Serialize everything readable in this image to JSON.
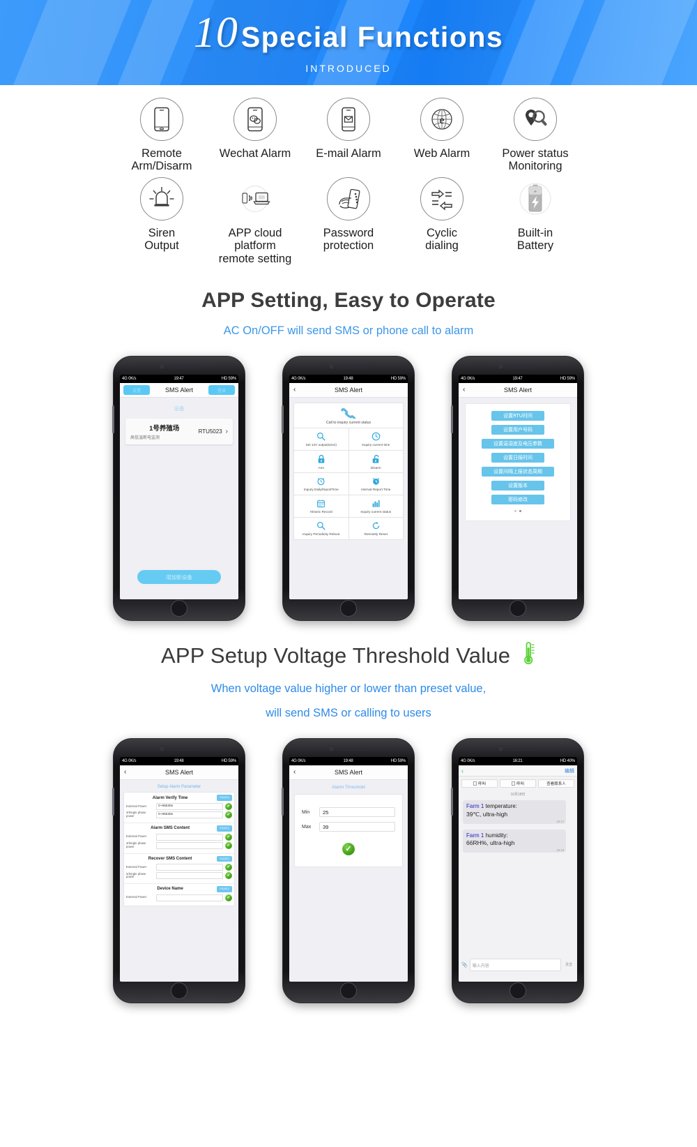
{
  "banner": {
    "number": "10",
    "title": "Special Functions",
    "subtitle": "INTRODUCED"
  },
  "features": {
    "row1": [
      {
        "icon": "smartphone-icon",
        "label": "Remote\nArm/Disarm"
      },
      {
        "icon": "wechat-chat-bubbles-icon",
        "label": "Wechat Alarm"
      },
      {
        "icon": "email-envelope-phone-icon",
        "label": "E-mail Alarm"
      },
      {
        "icon": "web-globe-icon",
        "label": "Web Alarm"
      },
      {
        "icon": "location-search-icon",
        "label": "Power status\nMonitoring"
      }
    ],
    "row2": [
      {
        "icon": "siren-light-icon",
        "label": "Siren\nOutput"
      },
      {
        "icon": "phone-to-laptop-icon",
        "label": "APP cloud platform\nremote setting"
      },
      {
        "icon": "hand-password-phone-icon",
        "label": "Password\nprotection"
      },
      {
        "icon": "cyclic-arrows-icon",
        "label": "Cyclic\ndialing"
      },
      {
        "icon": "battery-bolt-icon",
        "label": "Built-in\nBattery"
      }
    ]
  },
  "section1": {
    "title": "APP Setting, Easy to Operate",
    "subtitle": "AC On/OFF will send SMS or phone call to alarm"
  },
  "section2": {
    "title": "APP Setup Voltage Threshold Value",
    "icon": "thermometer-icon",
    "subtitle_line1": "When voltage value higher or lower than preset value,",
    "subtitle_line2": "will send SMS or calling to users"
  },
  "phone1": {
    "status_left": "4G  0K/s",
    "status_time": "19:47",
    "status_right": "HD  59%",
    "nav_left_button": "设置",
    "nav_title": "SMS Alert",
    "nav_right_button": "登录",
    "section_label": "设备",
    "device_name": "1号养殖场",
    "device_desc": "高低温断电监测",
    "device_model": "RTU5023",
    "chevron": "chevron-right-icon",
    "add_button": "增加新设备"
  },
  "phone2": {
    "status_left": "4G  0K/s",
    "status_time": "19:48",
    "status_right": "HD  59%",
    "nav_title": "SMS Alert",
    "back": "back-chevron-icon",
    "call_item": {
      "icon": "phone-handset-icon",
      "label": "Call to inquiry current status"
    },
    "grid": [
      [
        {
          "icon": "magnifier-icon",
          "label": "Set 12V output(siren)"
        },
        {
          "icon": "clock-icon",
          "label": "Inquiry current time"
        }
      ],
      [
        {
          "icon": "lock-closed-icon",
          "label": "Arm"
        },
        {
          "icon": "lock-open-icon",
          "label": "Disarm"
        }
      ],
      [
        {
          "icon": "alarm-clock-icon",
          "label": "Inquiry DailyReportTime"
        },
        {
          "icon": "alarm-clock-filled-icon",
          "label": "Interval Report Time"
        }
      ],
      [
        {
          "icon": "calendar-icon",
          "label": "Historic Record"
        },
        {
          "icon": "bar-chart-icon",
          "label": "Inquiry current status"
        }
      ],
      [
        {
          "icon": "magnifier-icon",
          "label": "Inquiry Periodicity Reboot"
        },
        {
          "icon": "refresh-icon",
          "label": "Remotely Reset"
        }
      ]
    ]
  },
  "phone3": {
    "status_left": "4G  0K/s",
    "status_time": "19:47",
    "status_right": "HD  59%",
    "nav_title": "SMS Alert",
    "back": "back-chevron-icon",
    "buttons": [
      "设置RTU时间",
      "设置用户号码",
      "设置温湿度及电压参数",
      "设置日报时间",
      "设置间隔上报状态周期",
      "设置版本",
      "密码修改"
    ]
  },
  "phone4": {
    "status_left": "4G  0K/s",
    "status_time": "19:48",
    "status_right": "HD  59%",
    "nav_title": "SMS Alert",
    "back": "back-chevron-icon",
    "form_title": "Setup Alarm Parameter",
    "groups": [
      {
        "title": "Alarm Verify Time",
        "button": "Inquiry",
        "rows": [
          {
            "key": "External Power",
            "value": "0~65535s"
          },
          {
            "key": "3/Single phase power",
            "value": "0~65535s"
          }
        ]
      },
      {
        "title": "Alarm SMS Content",
        "button": "Inquiry",
        "rows": [
          {
            "key": "External Power",
            "value": ""
          },
          {
            "key": "3/Single phase power",
            "value": ""
          }
        ]
      },
      {
        "title": "Recover SMS Content",
        "button": "Inquiry",
        "rows": [
          {
            "key": "External Power",
            "value": ""
          },
          {
            "key": "3/Single phase power",
            "value": ""
          }
        ]
      },
      {
        "title": "Device Name",
        "button": "Inquiry",
        "rows": [
          {
            "key": "External Power",
            "value": ""
          }
        ]
      }
    ]
  },
  "phone5": {
    "status_left": "4G  0K/s",
    "status_time": "19:48",
    "status_right": "HD  59%",
    "nav_title": "SMS Alert",
    "back": "back-chevron-icon",
    "form_title": "Alarm Threshold",
    "min_label": "Min",
    "min_value": "25",
    "max_label": "Max",
    "max_value": "39",
    "confirm_icon": "green-check-icon"
  },
  "phone6": {
    "status_left": "4G  0K/s",
    "status_time": "16:21",
    "status_right": "HD  40%",
    "back": "back-chevron-icon",
    "edit_button": "编辑",
    "actions": [
      "呼叫",
      "呼叫",
      "查看联系人"
    ],
    "date": "10月18日",
    "messages": [
      {
        "farm": "Farm 1",
        "rest": " temperature:",
        "line2": "39℃,  ultra-high",
        "time": "16:17"
      },
      {
        "farm": "Farm 1",
        "rest": " humidity:",
        "line2": "66RH%,  ultra-high",
        "time": "16:18"
      }
    ],
    "input_placeholder": "输入内容",
    "send_label": "发送"
  },
  "colors": {
    "banner_blue": "#2b8ef9",
    "accent_blue": "#3a97e8",
    "app_blue": "#67c4ea",
    "green": "#3c9a12"
  }
}
